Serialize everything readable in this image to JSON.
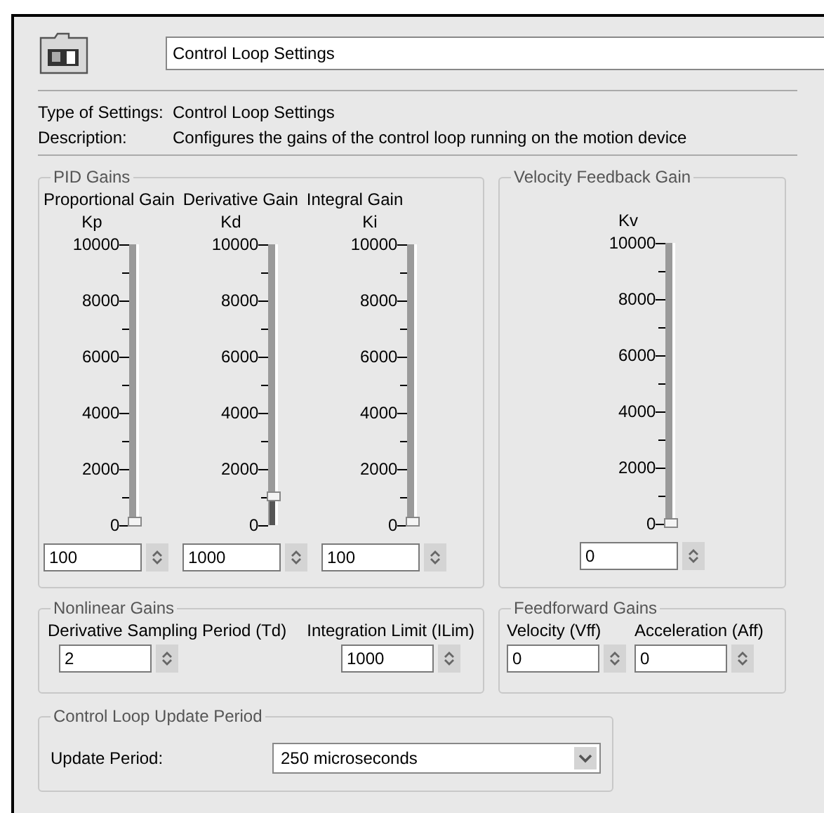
{
  "header": {
    "title": "Control Loop Settings"
  },
  "info": [
    {
      "label": "Type of Settings:",
      "value": "Control Loop Settings"
    },
    {
      "label": "Description:",
      "value": "Configures the gains of the control loop running on the motion device"
    }
  ],
  "pid_gains": {
    "title": "PID Gains",
    "sliders": [
      {
        "caption": "Proportional Gain",
        "symbol": "Kp",
        "scale": [
          "10000",
          "8000",
          "6000",
          "4000",
          "2000",
          "0"
        ],
        "level": 0.01,
        "value": "100"
      },
      {
        "caption": "Derivative Gain",
        "symbol": "Kd",
        "scale": [
          "10000",
          "8000",
          "6000",
          "4000",
          "2000",
          "0"
        ],
        "level": 0.1,
        "value": "1000"
      },
      {
        "caption": "Integral Gain",
        "symbol": "Ki",
        "scale": [
          "10000",
          "8000",
          "6000",
          "4000",
          "2000",
          "0"
        ],
        "level": 0.01,
        "value": "100"
      }
    ]
  },
  "velocity_feedback_gain": {
    "title": "Velocity Feedback Gain",
    "sliders": [
      {
        "symbol": "Kv",
        "scale": [
          "10000",
          "8000",
          "6000",
          "4000",
          "2000",
          "0"
        ],
        "level": 0,
        "value": "0"
      }
    ]
  },
  "nonlinear_gains": {
    "title": "Nonlinear Gains",
    "fields": [
      {
        "label": "Derivative Sampling Period (Td)",
        "value": "2"
      },
      {
        "label": "Integration Limit (ILim)",
        "value": "1000"
      }
    ]
  },
  "feedforward_gains": {
    "title": "Feedforward Gains",
    "fields": [
      {
        "label": "Velocity (Vff)",
        "value": "0"
      },
      {
        "label": "Acceleration  (Aff)",
        "value": "0"
      }
    ]
  },
  "update_period": {
    "title": "Control Loop Update Period",
    "label": "Update Period:",
    "value": "250 microseconds"
  }
}
